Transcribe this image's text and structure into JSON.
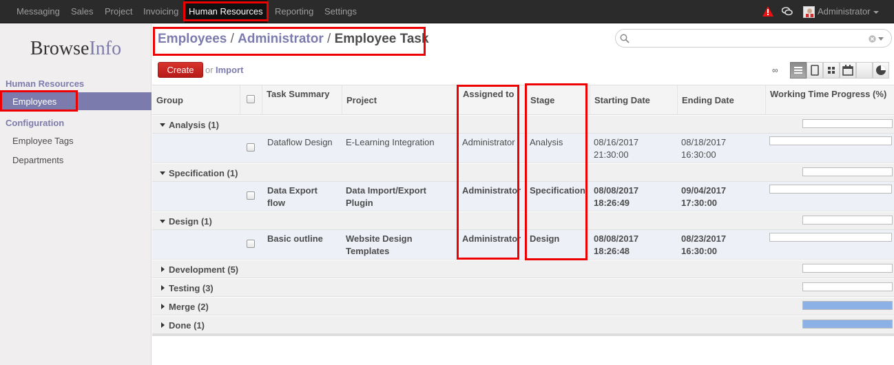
{
  "topbar": {
    "menu": [
      "Messaging",
      "Sales",
      "Project",
      "Invoicing",
      "Human Resources",
      "Reporting",
      "Settings"
    ],
    "active_menu": "Human Resources",
    "user": "Administrator"
  },
  "sidebar": {
    "logo_main": "Browse",
    "logo_accent": "Info",
    "section1": "Human Resources",
    "item_employees": "Employees",
    "section2": "Configuration",
    "item_tags": "Employee Tags",
    "item_departments": "Departments"
  },
  "breadcrumb": {
    "level1": "Employees",
    "level2": "Administrator",
    "current": "Employee Task",
    "separator": "/"
  },
  "search": {
    "placeholder": "",
    "value": ""
  },
  "actions": {
    "create": "Create",
    "or": "or",
    "import": "Import",
    "infinity": "∞"
  },
  "table": {
    "columns": {
      "group": "Group",
      "task_summary": "Task Summary",
      "project": "Project",
      "assigned_to": "Assigned to",
      "stage": "Stage",
      "starting_date": "Starting Date",
      "ending_date": "Ending Date",
      "progress": "Working Time Progress (%)"
    },
    "groups": [
      {
        "label": "Analysis (1)",
        "expanded": true,
        "progress": 0,
        "row": {
          "task": "Dataflow Design",
          "project": "E-Learning Integration",
          "assigned": "Administrator",
          "stage": "Analysis",
          "start_date": "08/16/2017",
          "start_time": "21:30:00",
          "end_date": "08/18/2017",
          "end_time": "16:30:00",
          "progress": 0,
          "bold": false
        }
      },
      {
        "label": "Specification (1)",
        "expanded": true,
        "progress": 0,
        "row": {
          "task": "Data Export",
          "task2": "flow",
          "project": "Data Import/Export",
          "project2": "Plugin",
          "assigned": "Administrator",
          "stage": "Specification",
          "start_date": "08/08/2017",
          "start_time": "18:26:49",
          "end_date": "09/04/2017",
          "end_time": "17:30:00",
          "progress": 0,
          "bold": true
        }
      },
      {
        "label": "Design (1)",
        "expanded": true,
        "progress": 0,
        "row": {
          "task": "Basic outline",
          "project": "Website Design",
          "project2": "Templates",
          "assigned": "Administrator",
          "stage": "Design",
          "start_date": "08/08/2017",
          "start_time": "18:26:48",
          "end_date": "08/23/2017",
          "end_time": "16:30:00",
          "progress": 0,
          "bold": true
        }
      },
      {
        "label": "Development (5)",
        "expanded": false,
        "progress": 0
      },
      {
        "label": "Testing (3)",
        "expanded": false,
        "progress": 0
      },
      {
        "label": "Merge (2)",
        "expanded": false,
        "progress": 1.0
      },
      {
        "label": "Done (1)",
        "expanded": false,
        "progress": 1.0
      }
    ]
  },
  "colors": {
    "accent": "#7c7bad",
    "highlight": "#ee0000",
    "topbar": "#2b2b2b",
    "create": "#c21d1d",
    "progress_fill": "#8bb1e6"
  }
}
